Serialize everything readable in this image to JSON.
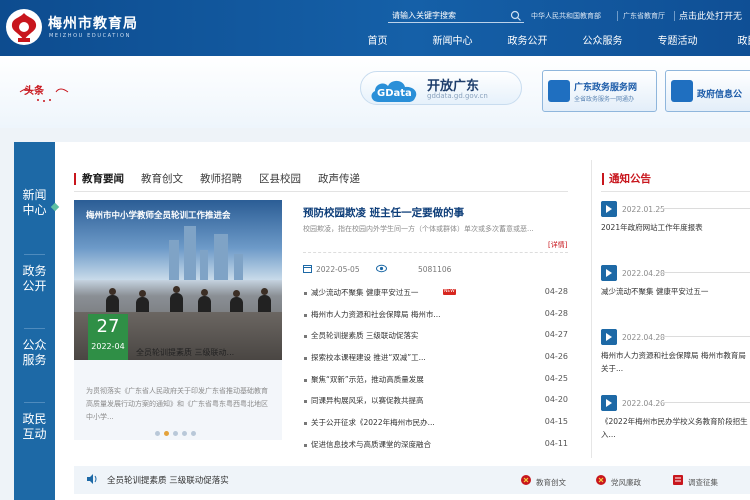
{
  "header": {
    "site_name": "梅州市教育局",
    "site_name_en": "MEIZHOU EDUCATION",
    "search_placeholder": "请输入关键字搜索",
    "top_links": [
      "中华人民共和国教育部",
      "广东省教育厅",
      "点击此处打开无"
    ],
    "nav": [
      "首页",
      "新闻中心",
      "政务公开",
      "公众服务",
      "专题活动",
      "政民互"
    ]
  },
  "banner": {
    "headline": "头条",
    "gdata_icon": "GData",
    "gdata_title": "开放广东",
    "gdata_url": "gddata.gd.gov.cn",
    "service_1_title": "广东政务服务网",
    "service_1_sub": "全省政务服务一网通办",
    "service_2_title": "政府信息公"
  },
  "sidebar": [
    "新闻中心",
    "政务公开",
    "公众服务",
    "政民互动"
  ],
  "tabs": [
    "教育要闻",
    "教育创文",
    "教师招聘",
    "区县校园",
    "政声传递"
  ],
  "feature": {
    "screen_title": "梅州市中小学教师全员轮训工作推进会",
    "day": "27",
    "year_month": "2022-04",
    "caption": "全员轮训提素质 三级联动...",
    "desc": "为贯彻落实《广东省人民政府关于印发广东省推动基础教育高质量发展行动方案的通知》和《广东省粤东粤西粤北地区中小学..."
  },
  "lead": {
    "title": "预防校园欺凌 班主任一定要做的事",
    "summary": "校园欺凌，指在校园内外学生间一方（个体或群体）单次或多次蓄意或恶...",
    "more": "[详情]",
    "date": "2022-05-05",
    "views": "5081106"
  },
  "news": [
    {
      "title": "减少流动不聚集 健康平安过五一",
      "date": "04-28",
      "is_new": true,
      "tag": "NEW"
    },
    {
      "title": "梅州市人力资源和社会保障局 梅州市...",
      "date": "04-28",
      "is_new": false
    },
    {
      "title": "全员轮训提素质 三级联动促落实",
      "date": "04-27",
      "is_new": false
    },
    {
      "title": "探索校本课程建设 推进“双减”工...",
      "date": "04-26",
      "is_new": false
    },
    {
      "title": "聚焦“双新”示范，推动高质量发展",
      "date": "04-25",
      "is_new": false
    },
    {
      "title": "同课异构展风采，以赛促教共提高",
      "date": "04-20",
      "is_new": false
    },
    {
      "title": "关于公开征求《2022年梅州市民办...",
      "date": "04-15",
      "is_new": false
    },
    {
      "title": "促进信息技术与高质课堂的深度融合",
      "date": "04-11",
      "is_new": false
    }
  ],
  "notices": {
    "heading": "通知公告",
    "items": [
      {
        "date": "2022.01.25",
        "title": "2021年政府网站工作年度报表"
      },
      {
        "date": "2022.04.28",
        "title": "减少流动不聚集 健康平安过五一"
      },
      {
        "date": "2022.04.28",
        "title": "梅州市人力资源和社会保障局 梅州市教育局关于..."
      },
      {
        "date": "2022.04.26",
        "title": "《2022年梅州市民办学校义务教育阶段招生入..."
      }
    ]
  },
  "ticker": {
    "text": "全员轮训提素质 三级联动促落实",
    "quick": [
      "教育创文",
      "党风廉政",
      "调查征集"
    ]
  },
  "colors": {
    "header_blue": "#1560a8",
    "sidebar_blue": "#1d69a6",
    "accent_red": "#c8161d",
    "badge_green": "#2f8f46"
  }
}
